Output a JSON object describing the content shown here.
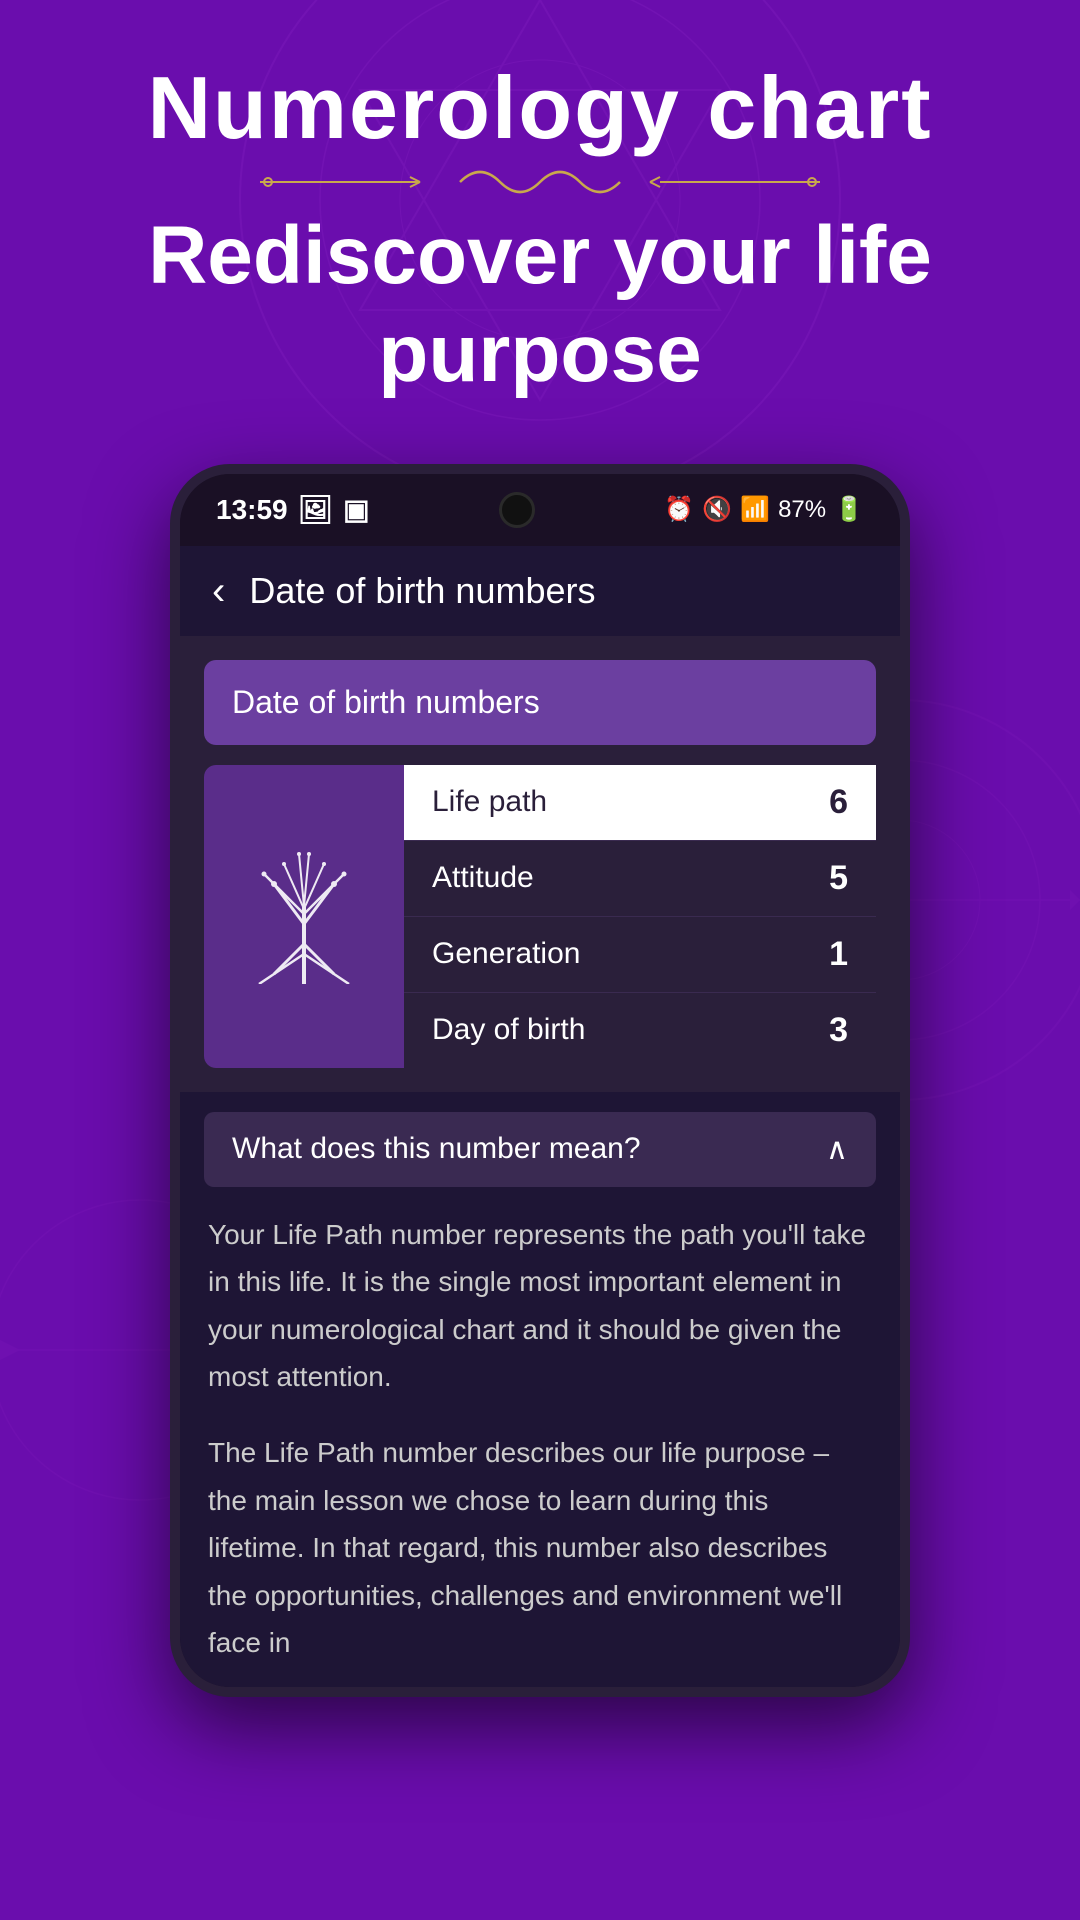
{
  "page": {
    "background_color": "#6a0dad",
    "title": "Numerology chart",
    "subtitle": "Rediscover your life purpose",
    "ornament_color": "#c9a84c"
  },
  "status_bar": {
    "time": "13:59",
    "battery": "87%",
    "icons": [
      "gallery",
      "screen-record",
      "alarm",
      "mute",
      "wifi",
      "signal",
      "battery"
    ]
  },
  "nav": {
    "back_label": "‹",
    "title": "Date of birth numbers"
  },
  "section": {
    "header": "Date of birth numbers",
    "icon_name": "tree-of-life-icon",
    "numbers": [
      {
        "label": "Life path",
        "value": "6",
        "active": true
      },
      {
        "label": "Attitude",
        "value": "5",
        "active": false
      },
      {
        "label": "Generation",
        "value": "1",
        "active": false
      },
      {
        "label": "Day of birth",
        "value": "3",
        "active": false
      }
    ]
  },
  "explanation": {
    "expand_label": "What does this number mean?",
    "paragraphs": [
      "Your Life Path number represents the path you'll take in this life. It is the single most important element in your numerological chart and it should be given the most attention.",
      "The Life Path number describes our life purpose – the main lesson we chose to learn during this lifetime. In that regard, this number also describes the opportunities, challenges and environment we'll face in"
    ]
  }
}
